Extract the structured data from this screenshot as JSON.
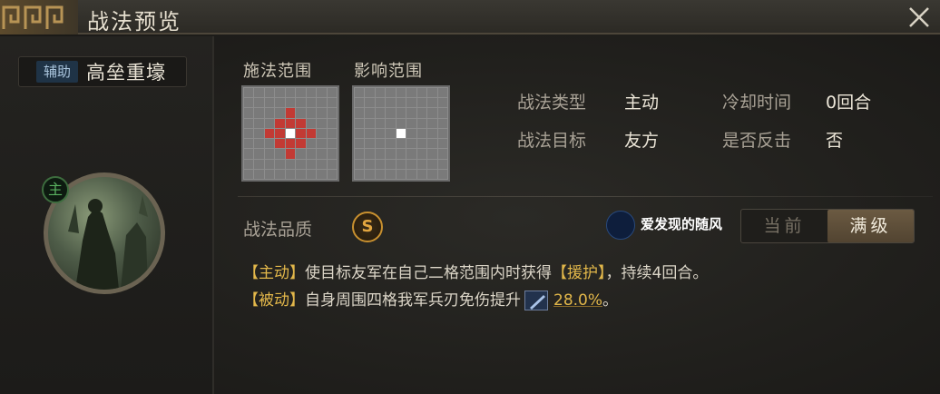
{
  "header": {
    "title": "战法预览"
  },
  "skill": {
    "role_tag": "辅助",
    "name": "高垒重壕",
    "main_badge": "主"
  },
  "grids": {
    "cast_label": "施法范围",
    "effect_label": "影响范围"
  },
  "info": {
    "type_label": "战法类型",
    "type_value": "主动",
    "target_label": "战法目标",
    "target_value": "友方",
    "cooldown_label": "冷却时间",
    "cooldown_value": "0回合",
    "counter_label": "是否反击",
    "counter_value": "否"
  },
  "quality": {
    "label": "战法品质",
    "grade": "S"
  },
  "watermark": {
    "text": "爱发现的随风"
  },
  "level_toggle": {
    "current": "当前",
    "max": "满级",
    "selected": "满级"
  },
  "description": {
    "line1": {
      "tag": "【主动】",
      "text1": "使目标友军在自己二格范围内时获得",
      "status": "【援护】",
      "text2": "，持续4回合。"
    },
    "line2": {
      "tag": "【被动】",
      "text1": "自身周围四格我军兵刃免伤提升",
      "value": "28.0%",
      "end": "。"
    }
  },
  "colors": {
    "accent_gold": "#e2b74a",
    "range_red": "#c23a34",
    "quality_orange": "#c8902f"
  }
}
